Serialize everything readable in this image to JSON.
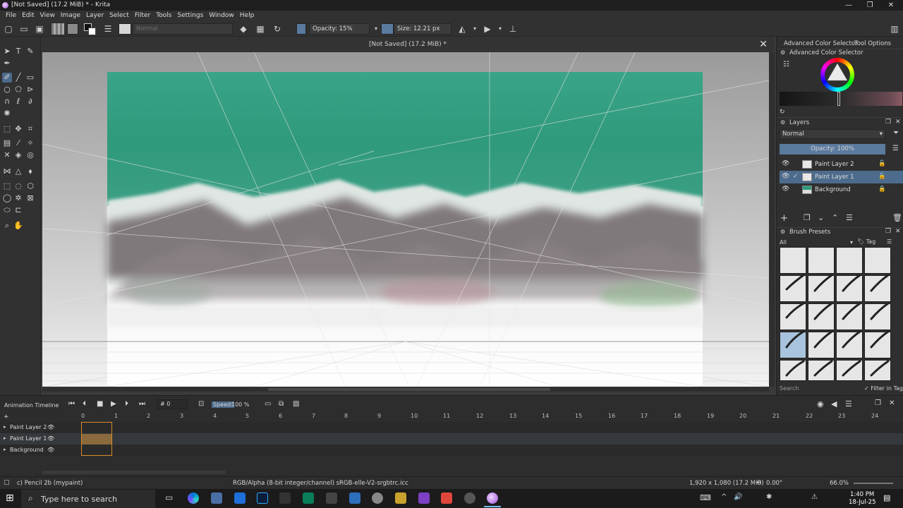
{
  "window": {
    "title": "[Not Saved]  (17.2 MiB)  * - Krita",
    "minimize": "—",
    "restore": "❐",
    "close": "✕"
  },
  "menu": [
    "File",
    "Edit",
    "View",
    "Image",
    "Layer",
    "Select",
    "Filter",
    "Tools",
    "Settings",
    "Window",
    "Help"
  ],
  "toolbar": {
    "blend_mode": "Normal",
    "opacity": "Opacity: 15%",
    "size": "Size: 12.21 px"
  },
  "document": {
    "tab_title": "[Not Saved]  (17.2 MiB) *",
    "close": "✕"
  },
  "right_tabs": {
    "advanced_color_selector": "Advanced Color Selector",
    "tool_options": "Tool Options"
  },
  "color_selector": {
    "title": "Advanced Color Selector"
  },
  "layers": {
    "title": "Layers",
    "blend_mode": "Normal",
    "opacity": "Opacity:  100%",
    "items": [
      {
        "name": "Paint Layer 2",
        "selected": false
      },
      {
        "name": "Paint Layer 1",
        "selected": true
      },
      {
        "name": "Background",
        "selected": false
      }
    ]
  },
  "brush_presets": {
    "title": "Brush Presets",
    "filter": "All",
    "tag": "Tag",
    "search_placeholder": "Search",
    "filter_in_tag": "Filter in Tag"
  },
  "timeline": {
    "title": "Animation Timeline",
    "frame": "0",
    "speed_label": "Speed:",
    "speed_value": "100 %",
    "frame_numbers": [
      "0",
      "1",
      "2",
      "3",
      "4",
      "5",
      "6",
      "7",
      "8",
      "9",
      "10",
      "11",
      "12",
      "13",
      "14",
      "15",
      "16",
      "17",
      "18",
      "19",
      "20",
      "21",
      "22",
      "23",
      "24"
    ],
    "layers": [
      "Paint Layer 2",
      "Paint Layer 1",
      "Background"
    ]
  },
  "status": {
    "brush": "c) Pencil 2b (mypaint)",
    "colorspace": "RGB/Alpha (8-bit integer/channel)  sRGB-elle-V2-srgbtrc.icc",
    "dimensions": "1,920 x 1,080 (17.2 MiB)",
    "rotation": "0.00°",
    "zoom": "66.0%"
  },
  "taskbar": {
    "search_placeholder": "Type here to search",
    "time": "1:40 PM",
    "date": "18-Jul-25"
  },
  "colors": {
    "selection": "#4d6b8c",
    "sky": "#2f9a7c",
    "accent_orange": "#d88a2c"
  }
}
